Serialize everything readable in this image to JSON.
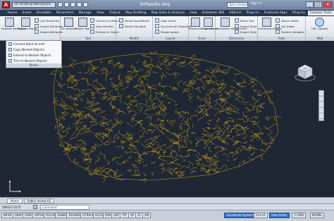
{
  "titlebar": {
    "app_button": "A",
    "workspace": "2D Drafting Workspace",
    "document_title": "Softpedia.dwg",
    "search_placeholder": "Type a keyword",
    "sign_in": "Sign In",
    "win_min": "_",
    "win_max": "□",
    "win_close": "✕"
  },
  "ribbon_tabs": [
    "Home",
    "Insert",
    "Annotate",
    "Parametric",
    "Manage",
    "View",
    "Output",
    "Map Drafting",
    "Map Data & Analysis",
    "Help",
    "Autodesk 360",
    "Add-Ins",
    "Plug-ins",
    "Featured Apps",
    "Plug-ins",
    "Express Tools"
  ],
  "ribbon": {
    "blocks_panel": {
      "explode": "Explode Attributes",
      "replace": "Replace Block",
      "rows": [
        "List Properties",
        "Import Attributes",
        "Export Attributes"
      ],
      "title": "Blocks"
    },
    "text_panel": {
      "arc_aligned": "Arc Aligned",
      "modify_text": "Modify Text",
      "rows": [
        "Convert to Mtext",
        "Auto Number",
        "Enclose in Object"
      ],
      "title": "Text"
    },
    "modify_panel": {
      "rows": [
        "Move/Copy/Rotate",
        "Stretch Multiple"
      ],
      "title": "Modify"
    },
    "layout_panel": {
      "rows": [
        "Align Space",
        "Synchronize Viewports",
        "Merge Layout"
      ],
      "title": "Layout"
    },
    "draw_panel": {
      "breakline": "Break-line Symbol",
      "super_hatch": "Super Hatch",
      "title": "Draw"
    },
    "dimension_panel": {
      "annotation": "Annotation Attachment",
      "rows": [
        "Reset Text",
        "Import Style",
        "Export Style"
      ],
      "title": "Dimension"
    },
    "tools_panel": {
      "command_aliases": "Command Aliases",
      "rows": [
        "Attach Xdata",
        "List Xdata",
        "System Variables"
      ],
      "title": "Tools"
    },
    "web_panel": {
      "url_options": "URL Options",
      "title": "Web"
    }
  },
  "blocks_menu": {
    "items": [
      "Convert block to xref",
      "Copy Nested Objects",
      "Extend to Nested Objects",
      "Trim to Nested Objects"
    ],
    "title": "Blocks"
  },
  "viewcube": {
    "top": "TOP"
  },
  "layout_tabs": [
    "Model",
    "Public review A3"
  ],
  "command": {
    "coords": "589537.0175",
    "placeholder": "Command"
  },
  "statusbar": {
    "items": [
      "INFER",
      "SNAP",
      "GRID",
      "ORTHO",
      "POLAR",
      "OSNAP",
      "3DOSNAP",
      "OTRACK",
      "DUCS",
      "DYN",
      "LWT",
      "TPY",
      "QP",
      "SC",
      "AM"
    ],
    "coordinate_system": "Coordinate System:",
    "cs_value": "ICH-10",
    "view_scale": "View Scale:",
    "view_scale_value": "1:1000",
    "model": "MODEL"
  },
  "colors": {
    "canvas": "#1f2735",
    "map_lines": "#c8a21a",
    "ribbon_bar": "#27364c"
  }
}
